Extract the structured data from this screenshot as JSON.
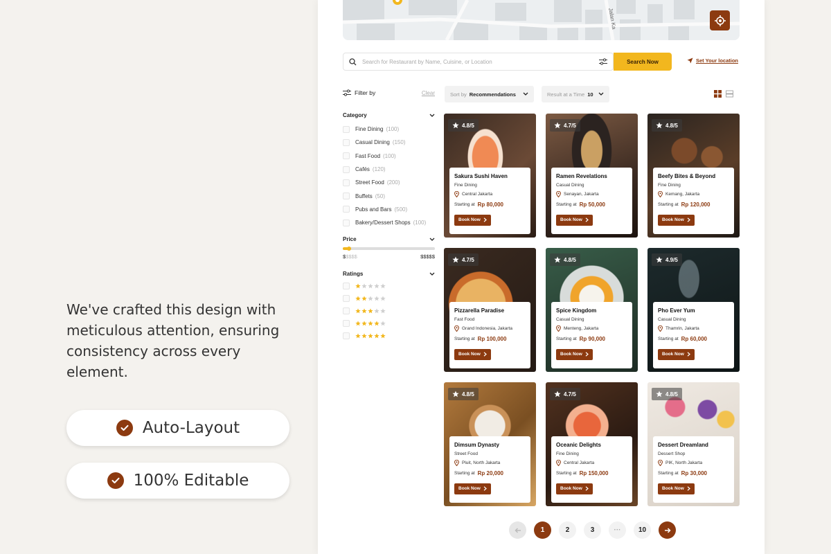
{
  "promo": {
    "text": "We've crafted this design with meticulous attention, ensuring consistency across every element.",
    "features": [
      "Auto-Layout",
      "100% Editable"
    ]
  },
  "map": {
    "street_label": "Jalan Ka"
  },
  "search": {
    "placeholder": "Search for Restaurant by Name, Cuisine, or Location",
    "button": "Search Now",
    "set_location": "Set Your location"
  },
  "filter": {
    "title": "Filter by",
    "clear": "Clear"
  },
  "toolbar": {
    "sort_prefix": "Sort by",
    "sort_value": "Recommendations",
    "result_prefix": "Result at a Time",
    "result_value": "10"
  },
  "sidebar": {
    "category_title": "Category",
    "categories": [
      {
        "label": "Fine Dining",
        "count": "(100)"
      },
      {
        "label": "Casual Dining",
        "count": "(150)"
      },
      {
        "label": "Fast Food",
        "count": "(100)"
      },
      {
        "label": "Cafés",
        "count": "(120)"
      },
      {
        "label": "Street Food",
        "count": "(200)"
      },
      {
        "label": "Buffets",
        "count": "(50)"
      },
      {
        "label": "Pubs and Bars",
        "count": "(500)"
      },
      {
        "label": "Bakery/Dessert Shops",
        "count": "(100)"
      }
    ],
    "price_title": "Price",
    "price_min_symbol": "$",
    "price_min_rest": "$$$$",
    "price_max": "$$$$$",
    "price_level": 0.02,
    "ratings_title": "Ratings",
    "ratings": [
      1,
      2,
      3,
      4,
      5
    ]
  },
  "restaurants": [
    {
      "rating": "4.8/5",
      "name": "Sakura Sushi Haven",
      "category": "Fine Dining",
      "location": "Central Jakarta",
      "price": "Rp 80,000"
    },
    {
      "rating": "4.7/5",
      "name": "Ramen Revelations",
      "category": "Casual Dining",
      "location": "Senayan, Jakarta",
      "price": "Rp 50,000"
    },
    {
      "rating": "4.8/5",
      "name": "Beefy Bites & Beyond",
      "category": "Fine Dining",
      "location": "Kemang, Jakarta",
      "price": "Rp 120,000"
    },
    {
      "rating": "4.7/5",
      "name": "Pizzarella Paradise",
      "category": "Fast Food",
      "location": "Grand Indonesia, Jakarta",
      "price": "Rp 100,000"
    },
    {
      "rating": "4.8/5",
      "name": "Spice Kingdom",
      "category": "Casual Dining",
      "location": "Menteng, Jakarta",
      "price": "Rp 90,000"
    },
    {
      "rating": "4.9/5",
      "name": "Pho Ever Yum",
      "category": "Casual Dining",
      "location": "Thamrin, Jakarta",
      "price": "Rp 60,000"
    },
    {
      "rating": "4.8/5",
      "name": "Dimsum Dynasty",
      "category": "Street Food",
      "location": "Pluit, North Jakarta",
      "price": "Rp 20,000"
    },
    {
      "rating": "4.7/5",
      "name": "Oceanic Delights",
      "category": "Fine Dining",
      "location": "Central Jakarta",
      "price": "Rp 150,000"
    },
    {
      "rating": "4.8/5",
      "name": "Dessert Dreamland",
      "category": "Dessert Shop",
      "location": "PIK, North Jakarta",
      "price": "Rp 30,000"
    }
  ],
  "card_labels": {
    "starting_at": "Starting at",
    "book": "Book Now"
  },
  "pagination": {
    "pages": [
      "1",
      "2",
      "3"
    ],
    "ellipsis": "···",
    "last": "10",
    "current": "1"
  },
  "colors": {
    "brand": "#8c3a10",
    "accent": "#f2b71e"
  }
}
